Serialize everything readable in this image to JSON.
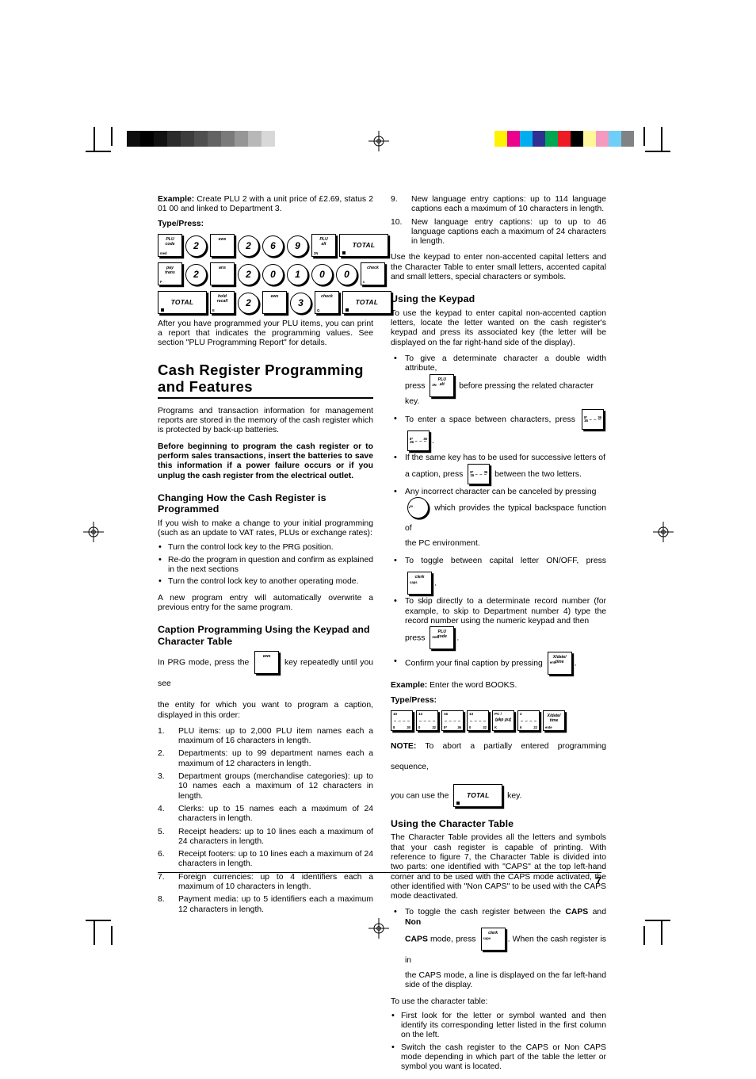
{
  "page": {
    "number": "7"
  },
  "marks": {
    "grey_swatches": [
      "#0d0d0d",
      "#000000",
      "#111111",
      "#2b2b2b",
      "#3d3d3d",
      "#4f4f4f",
      "#636363",
      "#7a7a7a",
      "#969696",
      "#b8b8b8",
      "#d8d8d8",
      "#ffffff"
    ],
    "color_swatches": [
      "#fff200",
      "#ec008c",
      "#00aeef",
      "#2e3192",
      "#00a651",
      "#ed1c24",
      "#000000",
      "#fff799",
      "#f49ac1",
      "#6dcff6",
      "#808285"
    ],
    "registration_icon": "registration-target-icon"
  },
  "left": {
    "example_label": "Example:",
    "example_text": "Create  PLU 2 with  a unit  price of £2.69, status 2 01 00 and linked to Department 3.",
    "typepress_label": "Type/Press:",
    "key_rows": [
      [
        {
          "shape": "sq",
          "center": "PLU\ncode",
          "bl": "med"
        },
        {
          "shape": "rnd",
          "digit": "2"
        },
        {
          "shape": "sq",
          "center": "ews"
        },
        {
          "shape": "rnd",
          "digit": "2"
        },
        {
          "shape": "rnd",
          "digit": "6"
        },
        {
          "shape": "rnd",
          "digit": "9"
        },
        {
          "shape": "sq",
          "center": "PLU\nalt",
          "bl": "2N"
        },
        {
          "shape": "wide",
          "label": "TOTAL",
          "square": true
        }
      ],
      [
        {
          "shape": "sq",
          "center": "pay\ntrans",
          "bl": "F"
        },
        {
          "shape": "rnd",
          "digit": "2"
        },
        {
          "shape": "sq",
          "center": "ans"
        },
        {
          "shape": "rnd",
          "digit": "2"
        },
        {
          "shape": "rnd",
          "digit": "0"
        },
        {
          "shape": "rnd",
          "digit": "1"
        },
        {
          "shape": "rnd",
          "digit": "0"
        },
        {
          "shape": "rnd",
          "digit": "0"
        },
        {
          "shape": "sq",
          "center": "check",
          "bl": "c"
        }
      ],
      [
        {
          "shape": "wide",
          "label": "TOTAL",
          "square": true
        },
        {
          "shape": "sq",
          "center": "hold\nrecall",
          "bl": "E"
        },
        {
          "shape": "rnd",
          "digit": "2"
        },
        {
          "shape": "sq",
          "center": "ews"
        },
        {
          "shape": "rnd",
          "digit": "3"
        },
        {
          "shape": "sq",
          "center": "check",
          "bl": "Q"
        },
        {
          "shape": "wide",
          "label": "TOTAL",
          "square": true
        }
      ]
    ],
    "after_report": "After you have programmed your PLU items, you can print a report that indicates the programming values. See section \"PLU Programming Report\" for details.",
    "heading_main": "Cash Register Programming and Features",
    "para_programs": "Programs and transaction information for management reports are stored in the memory of the cash register which is protected by back-up batteries.",
    "para_before_bold": "Before beginning to program the cash register or to perform sales transactions, insert the batteries to save this information if a power failure occurs or if you unplug the cash register from the electrical outlet.",
    "heading_changing": "Changing How the Cash Register is Programmed",
    "para_if_you_wish": "If you wish to make a change to your initial programming (such as an update to VAT rates, PLUs or exchange rates):",
    "changing_bullets": [
      "Turn the control lock key to the PRG position.",
      "Re-do the program in question and confirm as explained in the next sections",
      "Turn the control lock key to another operating mode."
    ],
    "para_new_program": "A new program entry will automatically overwrite a previous entry for the same program.",
    "heading_caption": "Caption Programming Using the Keypad and Character Table",
    "prg_pre": "In PRG mode, press the",
    "prg_key": {
      "shape": "sq",
      "center": "ews"
    },
    "prg_post": "key repeatedly until you see",
    "prg_tail": "the entity for which you want to program a caption, displayed in this order:",
    "entity_list": [
      "PLU items: up to 2,000 PLU item names each a maximum of 16 characters in length.",
      "Departments: up to 99 department names each a maximum of 12 characters in length.",
      "Department groups (merchandise categories): up to 10 names each a maximum of 12 characters in length.",
      "Clerks: up to 15 names each a maximum of 24 characters in length.",
      "Receipt headers: up to 10 lines each a maximum of 24 characters in length.",
      "Receipt footers: up to 10 lines each a maximum of 24 characters in length.",
      "Foreign currencies: up to 4 identifiers each a maximum of 10 characters in length.",
      "Payment media: up to 5 identifiers each a maximum 12 characters in length."
    ]
  },
  "right": {
    "entity_list_cont": [
      {
        "idx": "9.",
        "text": "New language entry captions: up to 114 language captions each a maximum of 10 characters in length."
      },
      {
        "idx": "10.",
        "text": "New language entry captions: up to up to 46 language captions each a maximum of 24 characters in length."
      }
    ],
    "para_use_keypad": "Use the keypad to enter non-accented capital letters and the Character Table to enter small letters, accented capital and small letters, special characters or symbols.",
    "heading_using_keypad": "Using the Keypad",
    "para_to_use": "To use the keypad to enter capital non-accented caption letters, locate the letter wanted on the cash register's keypad and press its associated key (the letter will be displayed on the far right-hand side of the display).",
    "b1_text": "To give a determinate character a double width attribute,",
    "b1_press": "press",
    "b1_key": {
      "shape": "sq",
      "center": "PLU\nalt",
      "bl": "2N"
    },
    "b1_after": "before pressing the related character",
    "b1_tail": "key.",
    "b2_text": "To enter a space between characters, press",
    "b2_keys": [
      {
        "shape": "small",
        "tl": "16",
        "bl": "8*",
        "br": "36"
      },
      {
        "shape": "small",
        "tl": "16",
        "bl": "8*",
        "br": "36"
      }
    ],
    "b3_text": "If the same key has to be used for successive letters of",
    "b3_press": "a caption, press",
    "b3_key": {
      "shape": "small",
      "tl": "16",
      "bl": "8*",
      "br": "36"
    },
    "b3_after": "between the two letters.",
    "b4_text": "Any incorrect character can be canceled by pressing",
    "b4_key": {
      "shape": "rnd",
      "digit": "·",
      "bl": "00 ."
    },
    "b4_after": "which provides the typical backspace function of",
    "b4_tail": "the PC environment.",
    "b5_text": "To toggle between capital letter ON/OFF, press",
    "b5_key": {
      "shape": "sq",
      "center": "clerk",
      "bl": "caps"
    },
    "b6_text": "To skip directly to a determinate record number (for example, to skip to Department number 4) type the record number using the numeric keypad and then",
    "b6_press": "press",
    "b6_key": {
      "shape": "sq",
      "center": "PLU\ncode",
      "bl": "med"
    },
    "b7_text": "Confirm your final caption by pressing",
    "b7_key": {
      "shape": "sq",
      "center": "X/date/\ntime",
      "bl": "ente"
    },
    "example_label": "Example:",
    "example_text": "Enter the word BOOKS.",
    "typepress_label": "Type/Press:",
    "books_keys": [
      {
        "shape": "small",
        "tl": "10",
        "bl": "8",
        "br": "30"
      },
      {
        "shape": "small",
        "tl": "13",
        "bl": "0",
        "br": "32"
      },
      {
        "shape": "small",
        "tl": "16",
        "bl": "8*",
        "br": "36"
      },
      {
        "shape": "small",
        "tl": "13",
        "bl": "0",
        "br": "32"
      },
      {
        "shape": "small",
        "tl": "PC /",
        "bl": "K",
        "br": "",
        "center2": "take out"
      },
      {
        "shape": "small",
        "tl": "2",
        "bl": "6",
        "br": "22"
      },
      {
        "shape": "small",
        "center": "X/date/\ntime",
        "bl": "ente"
      }
    ],
    "note_label": "NOTE:",
    "note_text": "To abort a partially entered programming sequence,",
    "note_pre": "you can use the",
    "note_key": {
      "shape": "wide",
      "label": "TOTAL",
      "square": true
    },
    "note_post": "key.",
    "heading_char_table": "Using the Character Table",
    "para_char_table": "The Character Table provides all the letters and symbols that your cash register is capable of printing. With reference to figure 7, the Character Table  is divided into two parts: one identified with \"CAPS\" at the top left-hand corner and to be used with the CAPS mode activated, the other identified with \"Non CAPS\" to be used with the CAPS mode deactivated.",
    "caps_b_pre": "To toggle the cash register between the",
    "caps_b_bold1": "CAPS",
    "caps_b_mid": "and",
    "caps_b_bold2": "Non",
    "caps_b_bold3": "CAPS",
    "caps_b_press": "mode, press",
    "caps_key": {
      "shape": "sq",
      "center": "clerk",
      "bl": "caps"
    },
    "caps_b_after": ". When the cash register is in",
    "caps_b_tail": "the CAPS mode, a line is displayed on the far left-hand side of the display.",
    "to_use_table": "To use the character table:",
    "table_bullets": [
      "First look for the letter or symbol wanted and then identify its corresponding letter listed in the first column on the left.",
      "Switch the cash register to the CAPS or Non CAPS mode depending in which part of the table the letter or symbol you want is located."
    ]
  }
}
